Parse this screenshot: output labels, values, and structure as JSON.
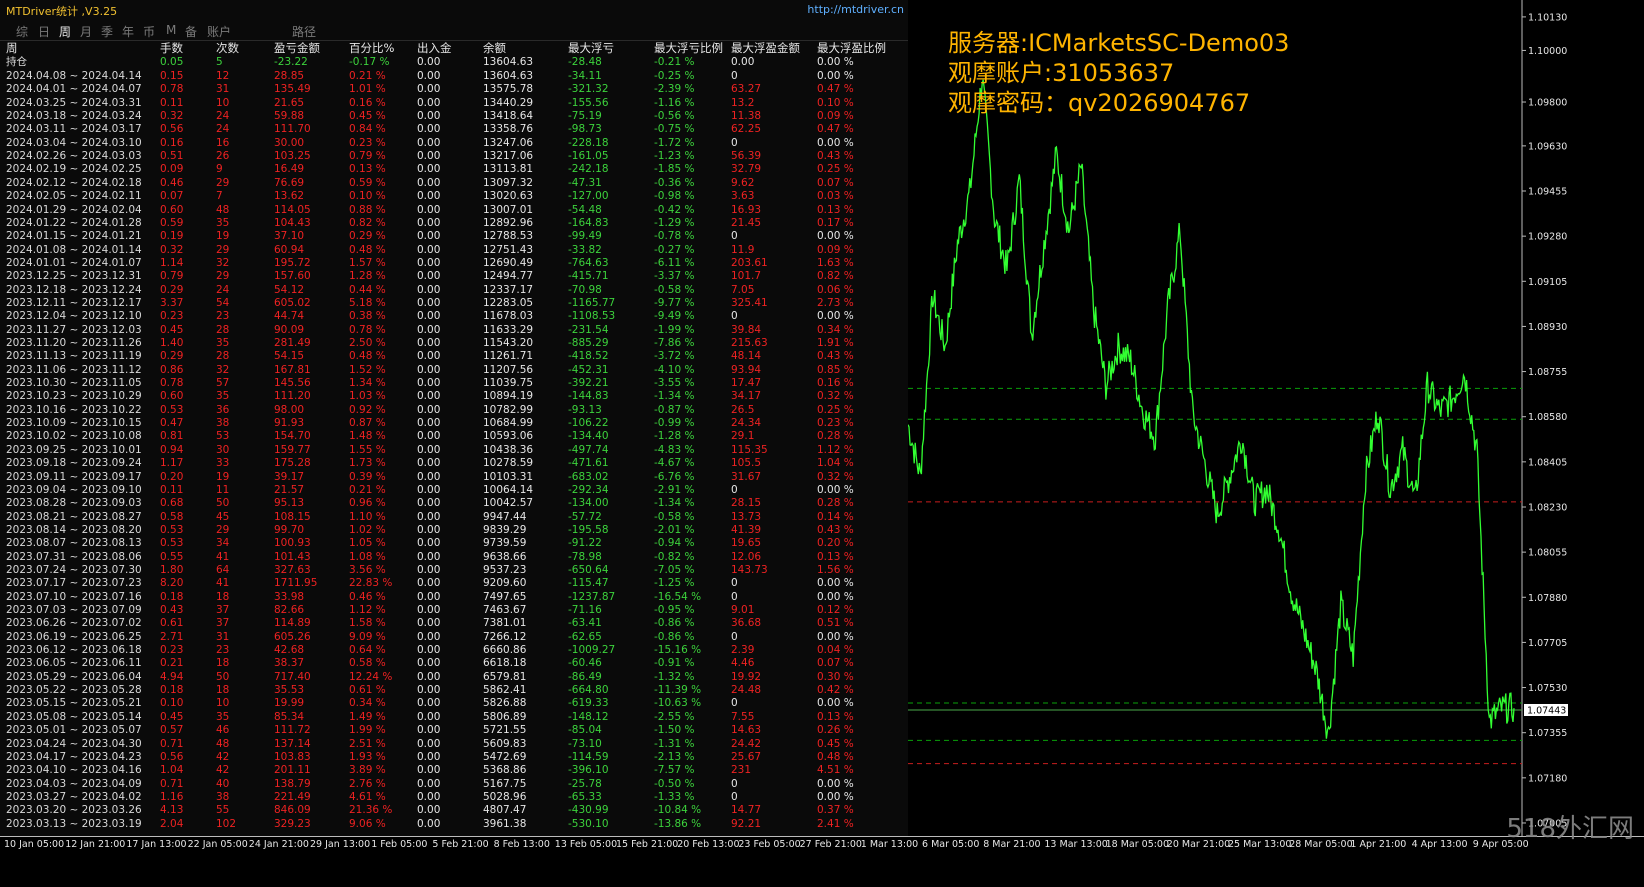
{
  "app": {
    "title": "MTDriver统计 ,V3.25",
    "url": "http://mtdriver.cn"
  },
  "tabs": [
    "综",
    "日",
    "周",
    "月",
    "季",
    "年",
    "币",
    "M",
    "备",
    "账户",
    "路径"
  ],
  "active_tab": "周",
  "columns": [
    "周",
    "手数",
    "次数",
    "盈亏金额",
    "百分比%",
    "出入金",
    "余额",
    "最大浮亏",
    "最大浮亏比例",
    "最大浮盈金额",
    "最大浮盈比例"
  ],
  "position_row": {
    "label": "持仓",
    "lots": "0.05",
    "count": "5",
    "pl": "-23.22",
    "pct": "-0.17 %",
    "io": "0.00",
    "bal": "13604.63",
    "mfl": "-28.48",
    "mflp": "-0.21 %",
    "mfp": "0.00",
    "mfpp": "0.00 %"
  },
  "rows": [
    [
      "2024.04.08 ~ 2024.04.14",
      "0.15",
      "12",
      "28.85",
      "0.21 %",
      "0.00",
      "13604.63",
      "-34.11",
      "-0.25 %",
      "0",
      "0.00 %"
    ],
    [
      "2024.04.01 ~ 2024.04.07",
      "0.78",
      "31",
      "135.49",
      "1.01 %",
      "0.00",
      "13575.78",
      "-321.32",
      "-2.39 %",
      "63.27",
      "0.47 %"
    ],
    [
      "2024.03.25 ~ 2024.03.31",
      "0.11",
      "10",
      "21.65",
      "0.16 %",
      "0.00",
      "13440.29",
      "-155.56",
      "-1.16 %",
      "13.2",
      "0.10 %"
    ],
    [
      "2024.03.18 ~ 2024.03.24",
      "0.32",
      "24",
      "59.88",
      "0.45 %",
      "0.00",
      "13418.64",
      "-75.19",
      "-0.56 %",
      "11.38",
      "0.09 %"
    ],
    [
      "2024.03.11 ~ 2024.03.17",
      "0.56",
      "24",
      "111.70",
      "0.84 %",
      "0.00",
      "13358.76",
      "-98.73",
      "-0.75 %",
      "62.25",
      "0.47 %"
    ],
    [
      "2024.03.04 ~ 2024.03.10",
      "0.16",
      "16",
      "30.00",
      "0.23 %",
      "0.00",
      "13247.06",
      "-228.18",
      "-1.72 %",
      "0",
      "0.00 %"
    ],
    [
      "2024.02.26 ~ 2024.03.03",
      "0.51",
      "26",
      "103.25",
      "0.79 %",
      "0.00",
      "13217.06",
      "-161.05",
      "-1.23 %",
      "56.39",
      "0.43 %"
    ],
    [
      "2024.02.19 ~ 2024.02.25",
      "0.09",
      "9",
      "16.49",
      "0.13 %",
      "0.00",
      "13113.81",
      "-242.18",
      "-1.85 %",
      "32.79",
      "0.25 %"
    ],
    [
      "2024.02.12 ~ 2024.02.18",
      "0.46",
      "29",
      "76.69",
      "0.59 %",
      "0.00",
      "13097.32",
      "-47.31",
      "-0.36 %",
      "9.62",
      "0.07 %"
    ],
    [
      "2024.02.05 ~ 2024.02.11",
      "0.07",
      "7",
      "13.62",
      "0.10 %",
      "0.00",
      "13020.63",
      "-127.00",
      "-0.98 %",
      "3.63",
      "0.03 %"
    ],
    [
      "2024.01.29 ~ 2024.02.04",
      "0.60",
      "48",
      "114.05",
      "0.88 %",
      "0.00",
      "13007.01",
      "-54.48",
      "-0.42 %",
      "16.93",
      "0.13 %"
    ],
    [
      "2024.01.22 ~ 2024.01.28",
      "0.59",
      "35",
      "104.43",
      "0.82 %",
      "0.00",
      "12892.96",
      "-164.83",
      "-1.29 %",
      "21.45",
      "0.17 %"
    ],
    [
      "2024.01.15 ~ 2024.01.21",
      "0.19",
      "19",
      "37.10",
      "0.29 %",
      "0.00",
      "12788.53",
      "-99.49",
      "-0.78 %",
      "0",
      "0.00 %"
    ],
    [
      "2024.01.08 ~ 2024.01.14",
      "0.32",
      "29",
      "60.94",
      "0.48 %",
      "0.00",
      "12751.43",
      "-33.82",
      "-0.27 %",
      "11.9",
      "0.09 %"
    ],
    [
      "2024.01.01 ~ 2024.01.07",
      "1.14",
      "32",
      "195.72",
      "1.57 %",
      "0.00",
      "12690.49",
      "-764.63",
      "-6.11 %",
      "203.61",
      "1.63 %"
    ],
    [
      "2023.12.25 ~ 2023.12.31",
      "0.79",
      "29",
      "157.60",
      "1.28 %",
      "0.00",
      "12494.77",
      "-415.71",
      "-3.37 %",
      "101.7",
      "0.82 %"
    ],
    [
      "2023.12.18 ~ 2023.12.24",
      "0.29",
      "24",
      "54.12",
      "0.44 %",
      "0.00",
      "12337.17",
      "-70.98",
      "-0.58 %",
      "7.05",
      "0.06 %"
    ],
    [
      "2023.12.11 ~ 2023.12.17",
      "3.37",
      "54",
      "605.02",
      "5.18 %",
      "0.00",
      "12283.05",
      "-1165.77",
      "-9.77 %",
      "325.41",
      "2.73 %"
    ],
    [
      "2023.12.04 ~ 2023.12.10",
      "0.23",
      "23",
      "44.74",
      "0.38 %",
      "0.00",
      "11678.03",
      "-1108.53",
      "-9.49 %",
      "0",
      "0.00 %"
    ],
    [
      "2023.11.27 ~ 2023.12.03",
      "0.45",
      "28",
      "90.09",
      "0.78 %",
      "0.00",
      "11633.29",
      "-231.54",
      "-1.99 %",
      "39.84",
      "0.34 %"
    ],
    [
      "2023.11.20 ~ 2023.11.26",
      "1.40",
      "35",
      "281.49",
      "2.50 %",
      "0.00",
      "11543.20",
      "-885.29",
      "-7.86 %",
      "215.63",
      "1.91 %"
    ],
    [
      "2023.11.13 ~ 2023.11.19",
      "0.29",
      "28",
      "54.15",
      "0.48 %",
      "0.00",
      "11261.71",
      "-418.52",
      "-3.72 %",
      "48.14",
      "0.43 %"
    ],
    [
      "2023.11.06 ~ 2023.11.12",
      "0.86",
      "32",
      "167.81",
      "1.52 %",
      "0.00",
      "11207.56",
      "-452.31",
      "-4.10 %",
      "93.94",
      "0.85 %"
    ],
    [
      "2023.10.30 ~ 2023.11.05",
      "0.78",
      "57",
      "145.56",
      "1.34 %",
      "0.00",
      "11039.75",
      "-392.21",
      "-3.55 %",
      "17.47",
      "0.16 %"
    ],
    [
      "2023.10.23 ~ 2023.10.29",
      "0.60",
      "35",
      "111.20",
      "1.03 %",
      "0.00",
      "10894.19",
      "-144.83",
      "-1.34 %",
      "34.17",
      "0.32 %"
    ],
    [
      "2023.10.16 ~ 2023.10.22",
      "0.53",
      "36",
      "98.00",
      "0.92 %",
      "0.00",
      "10782.99",
      "-93.13",
      "-0.87 %",
      "26.5",
      "0.25 %"
    ],
    [
      "2023.10.09 ~ 2023.10.15",
      "0.47",
      "38",
      "91.93",
      "0.87 %",
      "0.00",
      "10684.99",
      "-106.22",
      "-0.99 %",
      "24.34",
      "0.23 %"
    ],
    [
      "2023.10.02 ~ 2023.10.08",
      "0.81",
      "53",
      "154.70",
      "1.48 %",
      "0.00",
      "10593.06",
      "-134.40",
      "-1.28 %",
      "29.1",
      "0.28 %"
    ],
    [
      "2023.09.25 ~ 2023.10.01",
      "0.94",
      "30",
      "159.77",
      "1.55 %",
      "0.00",
      "10438.36",
      "-497.74",
      "-4.83 %",
      "115.35",
      "1.12 %"
    ],
    [
      "2023.09.18 ~ 2023.09.24",
      "1.17",
      "33",
      "175.28",
      "1.73 %",
      "0.00",
      "10278.59",
      "-471.61",
      "-4.67 %",
      "105.5",
      "1.04 %"
    ],
    [
      "2023.09.11 ~ 2023.09.17",
      "0.20",
      "19",
      "39.17",
      "0.39 %",
      "0.00",
      "10103.31",
      "-683.02",
      "-6.76 %",
      "31.67",
      "0.32 %"
    ],
    [
      "2023.09.04 ~ 2023.09.10",
      "0.11",
      "11",
      "21.57",
      "0.21 %",
      "0.00",
      "10064.14",
      "-292.34",
      "-2.91 %",
      "0",
      "0.00 %"
    ],
    [
      "2023.08.28 ~ 2023.09.03",
      "0.68",
      "50",
      "95.13",
      "0.96 %",
      "0.00",
      "10042.57",
      "-134.00",
      "-1.34 %",
      "28.15",
      "0.28 %"
    ],
    [
      "2023.08.21 ~ 2023.08.27",
      "0.58",
      "45",
      "108.15",
      "1.10 %",
      "0.00",
      "9947.44",
      "-57.72",
      "-0.58 %",
      "13.73",
      "0.14 %"
    ],
    [
      "2023.08.14 ~ 2023.08.20",
      "0.53",
      "29",
      "99.70",
      "1.02 %",
      "0.00",
      "9839.29",
      "-195.58",
      "-2.01 %",
      "41.39",
      "0.43 %"
    ],
    [
      "2023.08.07 ~ 2023.08.13",
      "0.53",
      "34",
      "100.93",
      "1.05 %",
      "0.00",
      "9739.59",
      "-91.22",
      "-0.94 %",
      "19.65",
      "0.20 %"
    ],
    [
      "2023.07.31 ~ 2023.08.06",
      "0.55",
      "41",
      "101.43",
      "1.08 %",
      "0.00",
      "9638.66",
      "-78.98",
      "-0.82 %",
      "12.06",
      "0.13 %"
    ],
    [
      "2023.07.24 ~ 2023.07.30",
      "1.80",
      "64",
      "327.63",
      "3.56 %",
      "0.00",
      "9537.23",
      "-650.64",
      "-7.05 %",
      "143.73",
      "1.56 %"
    ],
    [
      "2023.07.17 ~ 2023.07.23",
      "8.20",
      "41",
      "1711.95",
      "22.83 %",
      "0.00",
      "9209.60",
      "-115.47",
      "-1.25 %",
      "0",
      "0.00 %"
    ],
    [
      "2023.07.10 ~ 2023.07.16",
      "0.18",
      "18",
      "33.98",
      "0.46 %",
      "0.00",
      "7497.65",
      "-1237.87",
      "-16.54 %",
      "0",
      "0.00 %"
    ],
    [
      "2023.07.03 ~ 2023.07.09",
      "0.43",
      "37",
      "82.66",
      "1.12 %",
      "0.00",
      "7463.67",
      "-71.16",
      "-0.95 %",
      "9.01",
      "0.12 %"
    ],
    [
      "2023.06.26 ~ 2023.07.02",
      "0.61",
      "37",
      "114.89",
      "1.58 %",
      "0.00",
      "7381.01",
      "-63.41",
      "-0.86 %",
      "36.68",
      "0.51 %"
    ],
    [
      "2023.06.19 ~ 2023.06.25",
      "2.71",
      "31",
      "605.26",
      "9.09 %",
      "0.00",
      "7266.12",
      "-62.65",
      "-0.86 %",
      "0",
      "0.00 %"
    ],
    [
      "2023.06.12 ~ 2023.06.18",
      "0.23",
      "23",
      "42.68",
      "0.64 %",
      "0.00",
      "6660.86",
      "-1009.27",
      "-15.16 %",
      "2.39",
      "0.04 %"
    ],
    [
      "2023.06.05 ~ 2023.06.11",
      "0.21",
      "18",
      "38.37",
      "0.58 %",
      "0.00",
      "6618.18",
      "-60.46",
      "-0.91 %",
      "4.46",
      "0.07 %"
    ],
    [
      "2023.05.29 ~ 2023.06.04",
      "4.94",
      "50",
      "717.40",
      "12.24 %",
      "0.00",
      "6579.81",
      "-86.49",
      "-1.32 %",
      "19.92",
      "0.30 %"
    ],
    [
      "2023.05.22 ~ 2023.05.28",
      "0.18",
      "18",
      "35.53",
      "0.61 %",
      "0.00",
      "5862.41",
      "-664.80",
      "-11.39 %",
      "24.48",
      "0.42 %"
    ],
    [
      "2023.05.15 ~ 2023.05.21",
      "0.10",
      "10",
      "19.99",
      "0.34 %",
      "0.00",
      "5826.88",
      "-619.33",
      "-10.63 %",
      "0",
      "0.00 %"
    ],
    [
      "2023.05.08 ~ 2023.05.14",
      "0.45",
      "35",
      "85.34",
      "1.49 %",
      "0.00",
      "5806.89",
      "-148.12",
      "-2.55 %",
      "7.55",
      "0.13 %"
    ],
    [
      "2023.05.01 ~ 2023.05.07",
      "0.57",
      "46",
      "111.72",
      "1.99 %",
      "0.00",
      "5721.55",
      "-85.04",
      "-1.50 %",
      "14.63",
      "0.26 %"
    ],
    [
      "2023.04.24 ~ 2023.04.30",
      "0.71",
      "48",
      "137.14",
      "2.51 %",
      "0.00",
      "5609.83",
      "-73.10",
      "-1.31 %",
      "24.42",
      "0.45 %"
    ],
    [
      "2023.04.17 ~ 2023.04.23",
      "0.56",
      "42",
      "103.83",
      "1.93 %",
      "0.00",
      "5472.69",
      "-114.59",
      "-2.13 %",
      "25.67",
      "0.48 %"
    ],
    [
      "2023.04.10 ~ 2023.04.16",
      "1.04",
      "42",
      "201.11",
      "3.89 %",
      "0.00",
      "5368.86",
      "-396.10",
      "-7.57 %",
      "231",
      "4.51 %"
    ],
    [
      "2023.04.03 ~ 2023.04.09",
      "0.71",
      "40",
      "138.79",
      "2.76 %",
      "0.00",
      "5167.75",
      "-25.78",
      "-0.50 %",
      "0",
      "0.00 %"
    ],
    [
      "2023.03.27 ~ 2023.04.02",
      "1.16",
      "38",
      "221.49",
      "4.61 %",
      "0.00",
      "5028.96",
      "-65.33",
      "-1.33 %",
      "0",
      "0.00 %"
    ],
    [
      "2023.03.20 ~ 2023.03.26",
      "4.13",
      "55",
      "846.09",
      "21.36 %",
      "0.00",
      "4807.47",
      "-430.99",
      "-10.84 %",
      "14.77",
      "0.37 %"
    ],
    [
      "2023.03.13 ~ 2023.03.19",
      "2.04",
      "102",
      "329.23",
      "9.06 %",
      "0.00",
      "3961.38",
      "-530.10",
      "-13.86 %",
      "92.21",
      "2.41 %"
    ]
  ],
  "overlay": [
    "服务器:ICMarketsSC-Demo03",
    "观摩账户:31053637",
    "观摩密码：qv2026904767"
  ],
  "chart_data": {
    "type": "line",
    "title": "",
    "price_axis": [
      "1.10130",
      "1.10000",
      "1.09800",
      "1.09630",
      "1.09455",
      "1.09280",
      "1.09105",
      "1.08930",
      "1.08755",
      "1.08580",
      "1.08405",
      "1.08230",
      "1.08055",
      "1.07880",
      "1.07705",
      "1.07530",
      "1.07355",
      "1.07180",
      "1.07005"
    ],
    "price_range": [
      1.0697,
      1.1018
    ],
    "current_price": "1.07443",
    "time_labels": [
      "10 Jan 05:00",
      "12 Jan 21:00",
      "17 Jan 13:00",
      "22 Jan 05:00",
      "24 Jan 21:00",
      "29 Jan 13:00",
      "1 Feb 05:00",
      "5 Feb 21:00",
      "8 Feb 13:00",
      "13 Feb 05:00",
      "15 Feb 21:00",
      "20 Feb 13:00",
      "23 Feb 05:00",
      "27 Feb 21:00",
      "1 Mar 13:00",
      "6 Mar 05:00",
      "8 Mar 21:00",
      "13 Mar 13:00",
      "18 Mar 05:00",
      "20 Mar 21:00",
      "25 Mar 13:00",
      "28 Mar 05:00",
      "1 Apr 21:00",
      "4 Apr 13:00",
      "9 Apr 05:00"
    ],
    "series": [
      {
        "values": [
          1.0855,
          1.0835,
          1.0905,
          1.0885,
          1.0925,
          1.0945,
          1.099,
          1.0935,
          1.0915,
          1.095,
          1.089,
          1.0925,
          1.096,
          1.093,
          1.0955,
          1.09,
          1.087,
          1.0885,
          1.088,
          1.086,
          1.085,
          1.09,
          1.093,
          1.086,
          1.084,
          1.082,
          1.0835,
          1.085,
          1.0825,
          1.083,
          1.0815,
          1.079,
          1.0775,
          1.076,
          1.0735,
          1.0785,
          1.0765,
          1.0835,
          1.086,
          1.083,
          1.0845,
          1.0825,
          1.087,
          1.086,
          1.0865,
          1.0875,
          1.0845,
          1.074,
          1.0745,
          1.0745
        ]
      }
    ],
    "hlines": [
      {
        "value": 1.0869,
        "color": "#0aa00a",
        "style": "dashed"
      },
      {
        "value": 1.0857,
        "color": "#0aa00a",
        "style": "dashed"
      },
      {
        "value": 1.0825,
        "color": "#c81e1e",
        "style": "dashed"
      },
      {
        "value": 1.0747,
        "color": "#0aa00a",
        "style": "dashed"
      },
      {
        "value": 1.07443,
        "color": "#4aa84a",
        "style": "solid"
      },
      {
        "value": 1.07325,
        "color": "#0aa00a",
        "style": "dashed"
      },
      {
        "value": 1.07235,
        "color": "#c81e1e",
        "style": "dashed"
      }
    ],
    "line_color": "#32ff32",
    "grid": false
  },
  "watermark": "518外汇网"
}
